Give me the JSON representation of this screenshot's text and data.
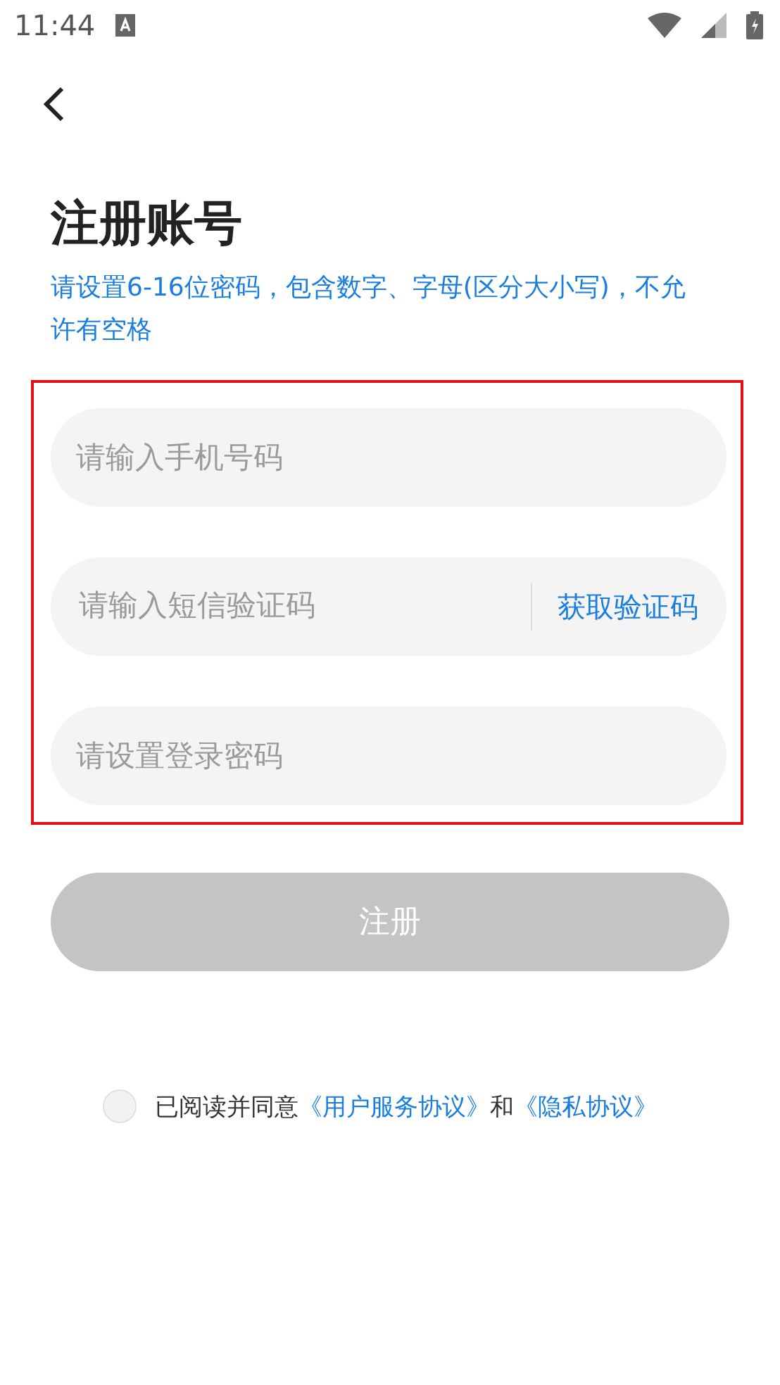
{
  "status_bar": {
    "time": "11:44"
  },
  "title": "注册账号",
  "hint": "请设置6-16位密码，包含数字、字母(区分大小写)，不允许有空格",
  "fields": [
    {
      "kind": "plain",
      "placeholder": "请输入手机号码"
    },
    {
      "kind": "code",
      "placeholder": "请输入短信验证码",
      "action": "获取验证码"
    },
    {
      "kind": "password",
      "placeholder": "请设置登录密码"
    }
  ],
  "register_button": {
    "label": "注册",
    "disabled": true
  },
  "agreement": {
    "checked": false,
    "parts": [
      {
        "kind": "text",
        "text": "已阅读并同意"
      },
      {
        "kind": "link",
        "text": "《用户服务协议》"
      },
      {
        "kind": "text",
        "text": "和"
      },
      {
        "kind": "link",
        "text": "《隐私协议》"
      }
    ]
  }
}
